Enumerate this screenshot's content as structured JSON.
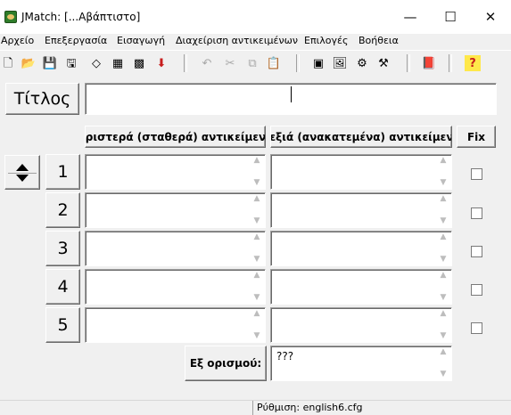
{
  "window": {
    "title": "JMatch: [...Αβάπτιστο]",
    "controls": {
      "minimize": "—",
      "maximize": "☐",
      "close": "✕"
    }
  },
  "menu": [
    "Αρχείο",
    "Επεξεργασία",
    "Εισαγωγή",
    "Διαχείριση αντικειμένων",
    "Επιλογές",
    "Βοήθεια"
  ],
  "toolbar": {
    "buttons": [
      {
        "name": "new-file-icon",
        "glyph": "🗋",
        "enabled": true
      },
      {
        "name": "open-folder-icon",
        "glyph": "📂",
        "enabled": true
      },
      {
        "name": "save-icon",
        "glyph": "💾",
        "enabled": true
      },
      {
        "name": "save-as-icon",
        "glyph": "🖫",
        "enabled": true
      },
      {
        "name": "diamond-icon",
        "glyph": "◇",
        "enabled": true
      },
      {
        "name": "web-export-icon",
        "glyph": "▦",
        "enabled": true
      },
      {
        "name": "web-export-2-icon",
        "glyph": "▩",
        "enabled": true
      },
      {
        "name": "down-arrow-icon",
        "glyph": "⬇",
        "enabled": true
      },
      {
        "name": "undo-icon",
        "glyph": "↶",
        "enabled": false
      },
      {
        "name": "cut-icon",
        "glyph": "✂",
        "enabled": false
      },
      {
        "name": "copy-icon",
        "glyph": "⧉",
        "enabled": false
      },
      {
        "name": "paste-icon",
        "glyph": "📋",
        "enabled": true
      },
      {
        "name": "html-icon",
        "glyph": "▣",
        "enabled": true
      },
      {
        "name": "image-icon",
        "glyph": "🖼",
        "enabled": true
      },
      {
        "name": "tool-icon",
        "glyph": "⚙",
        "enabled": true
      },
      {
        "name": "tool-2-icon",
        "glyph": "⚒",
        "enabled": true
      },
      {
        "name": "book-icon",
        "glyph": "📕",
        "enabled": true
      },
      {
        "name": "help-icon",
        "glyph": "?",
        "enabled": true
      }
    ]
  },
  "title_label": "Τίτλος",
  "title_value": "",
  "columns": {
    "left": "Αριστερά (σταθερά) αντικείμενα",
    "right": "Δεξιά (ανακατεμένα) αντικείμενα",
    "fix": "Fix"
  },
  "rows": [
    {
      "num": "1",
      "left": "",
      "right": "",
      "fixed": false
    },
    {
      "num": "2",
      "left": "",
      "right": "",
      "fixed": false
    },
    {
      "num": "3",
      "left": "",
      "right": "",
      "fixed": false
    },
    {
      "num": "4",
      "left": "",
      "right": "",
      "fixed": false
    },
    {
      "num": "5",
      "left": "",
      "right": "",
      "fixed": false
    }
  ],
  "default_label": "Εξ ορισμού:",
  "default_value": "???",
  "status": "Ρύθμιση: english6.cfg"
}
